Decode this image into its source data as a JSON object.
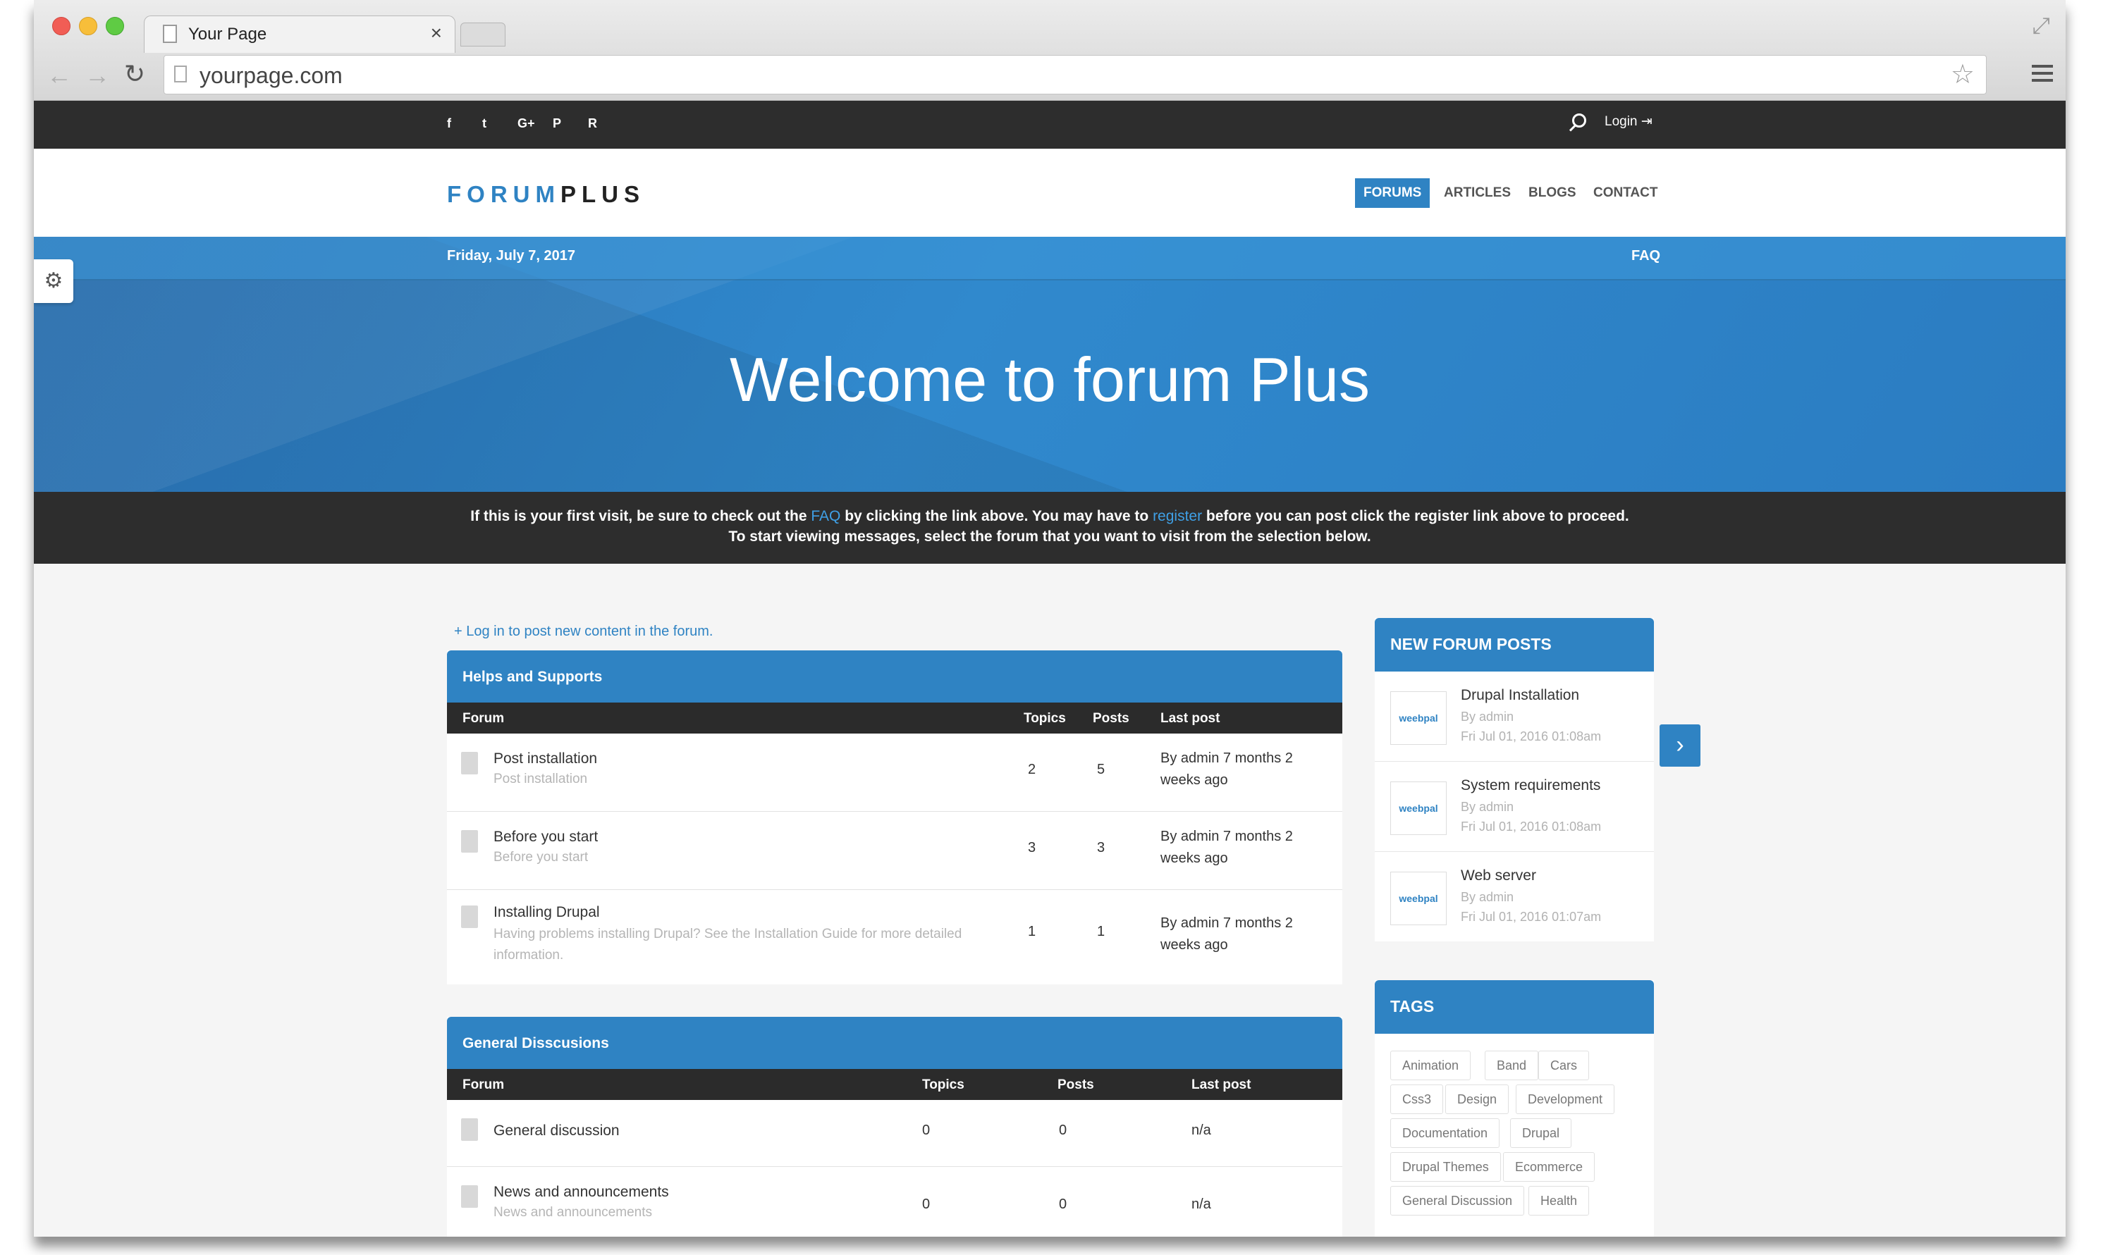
{
  "browser": {
    "tab_title": "Your Page",
    "tab_close": "×",
    "url": "yourpage.com"
  },
  "topbar": {
    "social_icons": [
      "facebook-icon",
      "twitter-icon",
      "google-plus-icon",
      "pinterest-icon",
      "rss-icon"
    ],
    "social_glyphs": [
      "f",
      "t",
      "G+",
      "P",
      "R"
    ],
    "login": "Login ⇥"
  },
  "header": {
    "logo_part1": "FORUM",
    "logo_part2": "PLUS",
    "nav": [
      "FORUMS",
      "ARTICLES",
      "BLOGS",
      "CONTACT"
    ],
    "active_nav": "FORUMS"
  },
  "hero": {
    "date": "Friday, July 7, 2017",
    "faq": "FAQ",
    "title": "Welcome to forum Plus"
  },
  "notice": {
    "line1_a": "If this is your first visit, be sure to check out the ",
    "line1_faq": "FAQ",
    "line1_b": " by clicking the link above. You may have to ",
    "line1_register": "register",
    "line1_c": " before you can post click the register link above to proceed.",
    "line2": "To start viewing messages, select the forum that you want to visit from the selection below."
  },
  "forum": {
    "login_to_post": "+ Log in to post new content in the forum.",
    "sections": [
      {
        "title": "Helps and Supports",
        "columns": [
          "Forum",
          "Topics",
          "Posts",
          "Last post"
        ],
        "rows": [
          {
            "title": "Post installation",
            "desc": "Post installation",
            "topics": "2",
            "posts": "5",
            "last_line1": "By admin 7 months 2",
            "last_line2": "weeks ago"
          },
          {
            "title": "Before you start",
            "desc": "Before you start",
            "topics": "3",
            "posts": "3",
            "last_line1": "By admin 7 months 2",
            "last_line2": "weeks ago"
          },
          {
            "title": "Installing Drupal",
            "desc_line1": "Having problems installing Drupal? See the Installation Guide for more detailed",
            "desc_line2": "information.",
            "topics": "1",
            "posts": "1",
            "last_line1": "By admin 7 months 2",
            "last_line2": "weeks ago"
          }
        ]
      },
      {
        "title": "General Disscusions",
        "columns": [
          "Forum",
          "Topics",
          "Posts",
          "Last post"
        ],
        "rows": [
          {
            "title": "General discussion",
            "desc": "",
            "topics": "0",
            "posts": "0",
            "last": "n/a"
          },
          {
            "title": "News and announcements",
            "desc": "News and announcements",
            "topics": "0",
            "posts": "0",
            "last": "n/a"
          }
        ]
      }
    ]
  },
  "sidebar": {
    "new_posts_title": "NEW FORUM POSTS",
    "posts": [
      {
        "title": "Drupal Installation",
        "by": "By admin",
        "date": "Fri Jul 01, 2016 01:08am",
        "thumb": "weebpal"
      },
      {
        "title": "System requirements",
        "by": "By admin",
        "date": "Fri Jul 01, 2016 01:08am",
        "thumb": "weebpal"
      },
      {
        "title": "Web server",
        "by": "By admin",
        "date": "Fri Jul 01, 2016 01:07am",
        "thumb": "weebpal"
      }
    ],
    "tags_title": "TAGS",
    "tags": [
      "Animation",
      "Band",
      "Cars",
      "Css3",
      "Design",
      "Development",
      "Documentation",
      "Drupal",
      "Drupal Themes",
      "Ecommerce",
      "General Discussion",
      "Health"
    ]
  },
  "colors": {
    "accent": "#2f83c3",
    "dark": "#2d2d2d"
  }
}
